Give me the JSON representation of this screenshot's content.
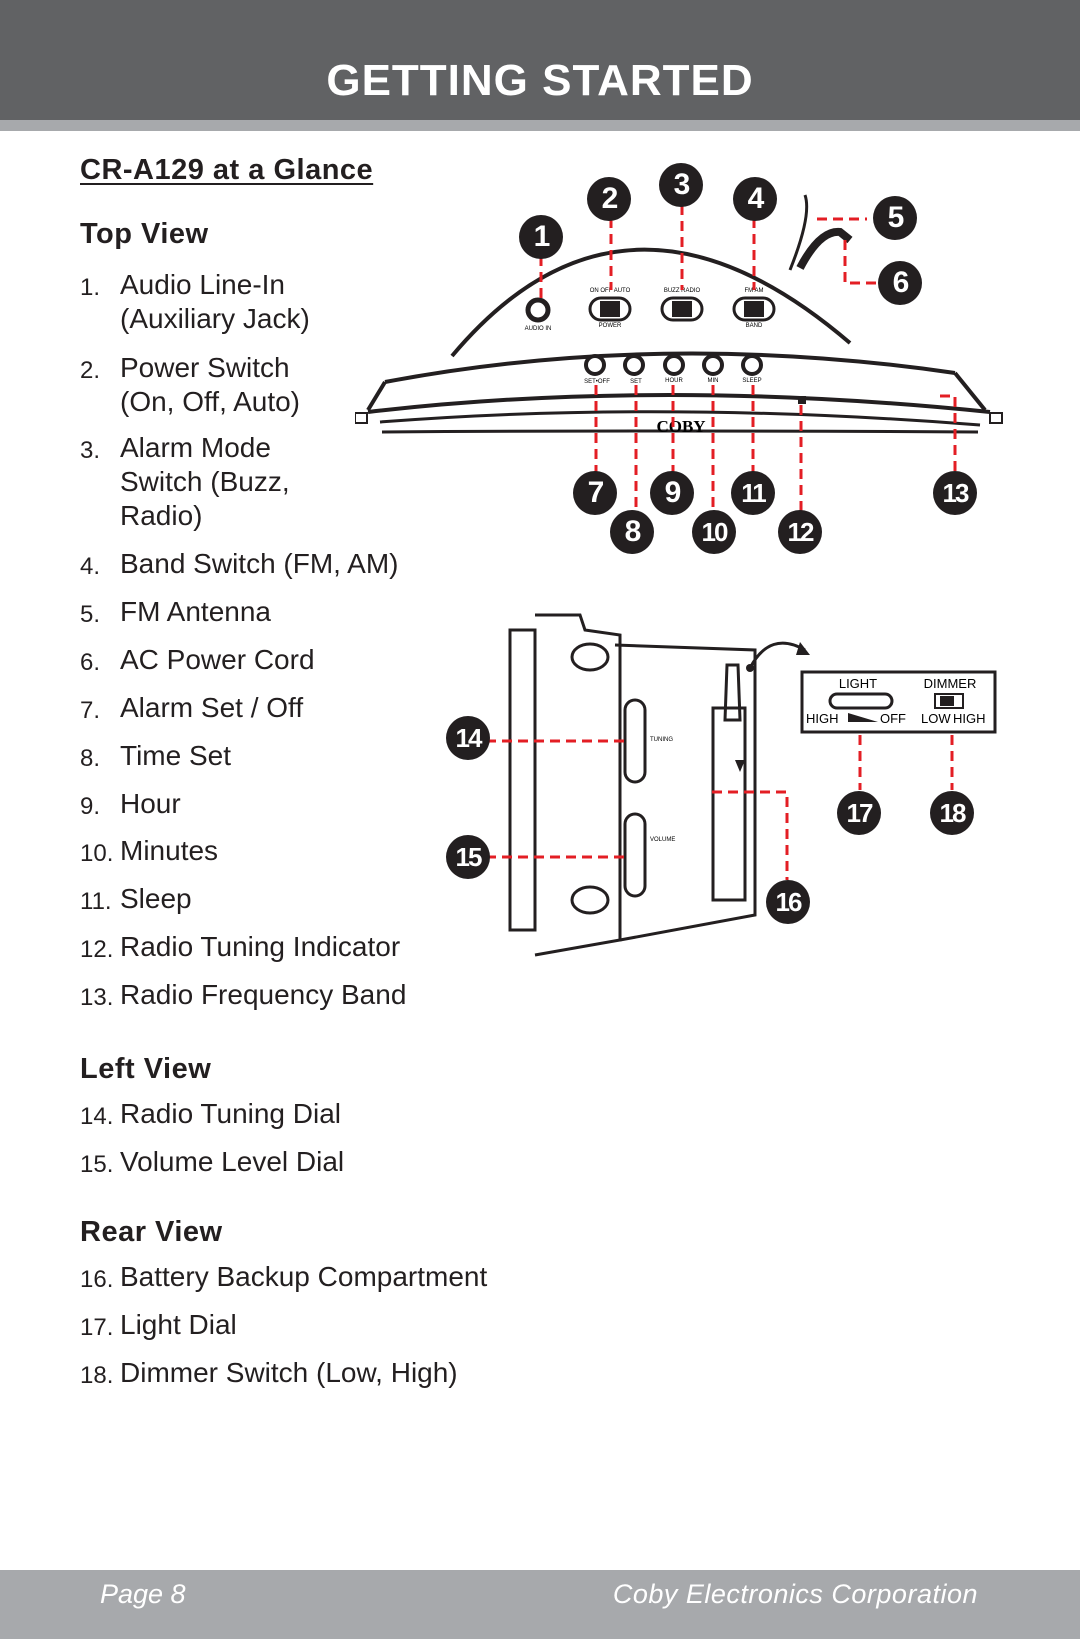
{
  "header": {
    "title": "GETTING STARTED"
  },
  "section_title": "CR-A129 at a Glance",
  "top_view": {
    "heading": "Top View",
    "items": [
      {
        "num": "1.",
        "label": "Audio Line-In\n(Auxiliary Jack)"
      },
      {
        "num": "2.",
        "label": "Power Switch\n(On, Off, Auto)"
      },
      {
        "num": "3.",
        "label": "Alarm Mode\nSwitch (Buzz,\nRadio)"
      },
      {
        "num": "4.",
        "label": "Band Switch (FM, AM)"
      },
      {
        "num": "5.",
        "label": "FM Antenna"
      },
      {
        "num": "6.",
        "label": "AC Power Cord"
      },
      {
        "num": "7.",
        "label": "Alarm Set / Off"
      },
      {
        "num": "8.",
        "label": "Time Set"
      },
      {
        "num": "9.",
        "label": "Hour"
      },
      {
        "num": "10.",
        "label": "Minutes"
      },
      {
        "num": "11.",
        "label": "Sleep"
      },
      {
        "num": "12.",
        "label": "Radio Tuning Indicator"
      },
      {
        "num": "13.",
        "label": "Radio Frequency Band"
      }
    ]
  },
  "left_view": {
    "heading": "Left View",
    "items": [
      {
        "num": "14.",
        "label": "Radio Tuning Dial"
      },
      {
        "num": "15.",
        "label": "Volume Level Dial"
      }
    ]
  },
  "rear_view": {
    "heading": "Rear View",
    "items": [
      {
        "num": "16.",
        "label": "Battery Backup Compartment"
      },
      {
        "num": "17.",
        "label": "Light Dial"
      },
      {
        "num": "18.",
        "label": "Dimmer Switch (Low, High)"
      }
    ]
  },
  "diagram_top": {
    "callouts": [
      "1",
      "2",
      "3",
      "4",
      "5",
      "6",
      "7",
      "8",
      "9",
      "10",
      "11",
      "12",
      "13"
    ],
    "device_labels": {
      "audio_in": "AUDIO IN",
      "power_opts": "ON  OFF  AUTO",
      "power": "POWER",
      "alarm_opts": "BUZZ  RADIO",
      "band_opts": "FM  AM",
      "band": "BAND",
      "btn_alarm": "SET•OFF",
      "btn_set": "SET",
      "btn_hour": "HOUR",
      "btn_min": "MIN",
      "btn_sleep": "SLEEP",
      "brand": "COBY"
    },
    "accent_color": "#e31e24"
  },
  "diagram_side": {
    "callouts": [
      "14",
      "15",
      "16",
      "17",
      "18"
    ],
    "device_labels": {
      "tuning": "TUNING",
      "volume": "VOLUME",
      "light": "LIGHT",
      "dimmer": "DIMMER",
      "high": "HIGH",
      "off": "OFF",
      "low": "LOW",
      "high2": "HIGH"
    }
  },
  "footer": {
    "page": "Page 8",
    "company": "Coby Electronics Corporation"
  }
}
